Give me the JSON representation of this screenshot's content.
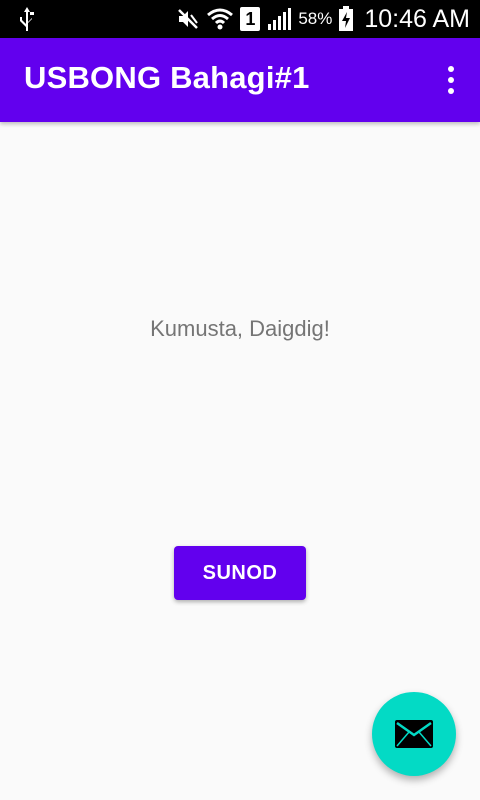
{
  "status_bar": {
    "battery_percent": "58%",
    "sim_slot": "1",
    "time": "10:46 AM",
    "icons": [
      "usb-icon",
      "mute-icon",
      "wifi-icon",
      "sim-icon",
      "signal-icon",
      "battery-charging-icon"
    ]
  },
  "app_bar": {
    "title": "USBONG Bahagi#1",
    "overflow_icon": "more-vert-icon"
  },
  "main": {
    "greeting": "Kumusta, Daigdig!",
    "button_label": "SUNOD"
  },
  "fab": {
    "icon": "email-icon"
  },
  "colors": {
    "primary": "#6200ee",
    "accent": "#03dac5",
    "background": "#fafafa",
    "status_bar": "#000000",
    "text_secondary": "#757575"
  }
}
